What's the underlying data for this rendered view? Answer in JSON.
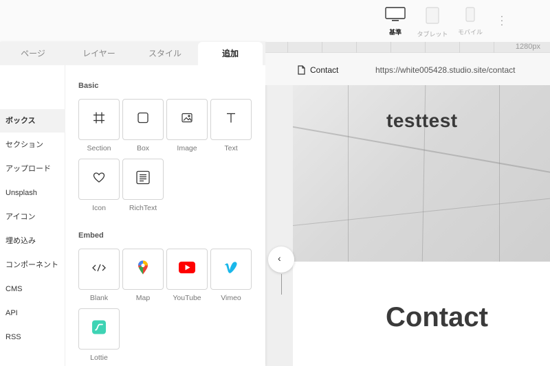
{
  "topbar": {
    "devices": [
      {
        "label": "基準",
        "icon": "desktop-icon",
        "active": true
      },
      {
        "label": "タブレット",
        "icon": "tablet-icon",
        "active": false
      },
      {
        "label": "モバイル",
        "icon": "mobile-icon",
        "active": false
      }
    ],
    "more_icon": "kebab-icon"
  },
  "panel": {
    "tabs": [
      "ページ",
      "レイヤー",
      "スタイル",
      "追加"
    ],
    "active_tab": "追加",
    "sidebar": [
      "ボックス",
      "セクション",
      "アップロード",
      "Unsplash",
      "アイコン",
      "埋め込み",
      "コンポーネント",
      "CMS",
      "API",
      "RSS"
    ],
    "active_sidebar": "ボックス",
    "basic": {
      "title": "Basic",
      "items": [
        {
          "label": "Section",
          "icon": "section-icon"
        },
        {
          "label": "Box",
          "icon": "box-icon"
        },
        {
          "label": "Image",
          "icon": "image-icon"
        },
        {
          "label": "Text",
          "icon": "text-icon"
        },
        {
          "label": "Icon",
          "icon": "heart-icon"
        },
        {
          "label": "RichText",
          "icon": "richtext-icon"
        }
      ]
    },
    "embed": {
      "title": "Embed",
      "items": [
        {
          "label": "Blank",
          "icon": "code-icon"
        },
        {
          "label": "Map",
          "icon": "map-pin-icon"
        },
        {
          "label": "YouTube",
          "icon": "youtube-icon"
        },
        {
          "label": "Vimeo",
          "icon": "vimeo-icon"
        },
        {
          "label": "Lottie",
          "icon": "lottie-icon"
        }
      ]
    }
  },
  "preview": {
    "ruler_size": "1280px",
    "page_name": "Contact",
    "url": "https://white005428.studio.site/contact",
    "hero_title": "testtest",
    "contact_title": "Contact"
  },
  "colors": {
    "youtube": "#ff0000",
    "vimeo": "#1ab7ea",
    "lottie": "#3ed3b4"
  }
}
